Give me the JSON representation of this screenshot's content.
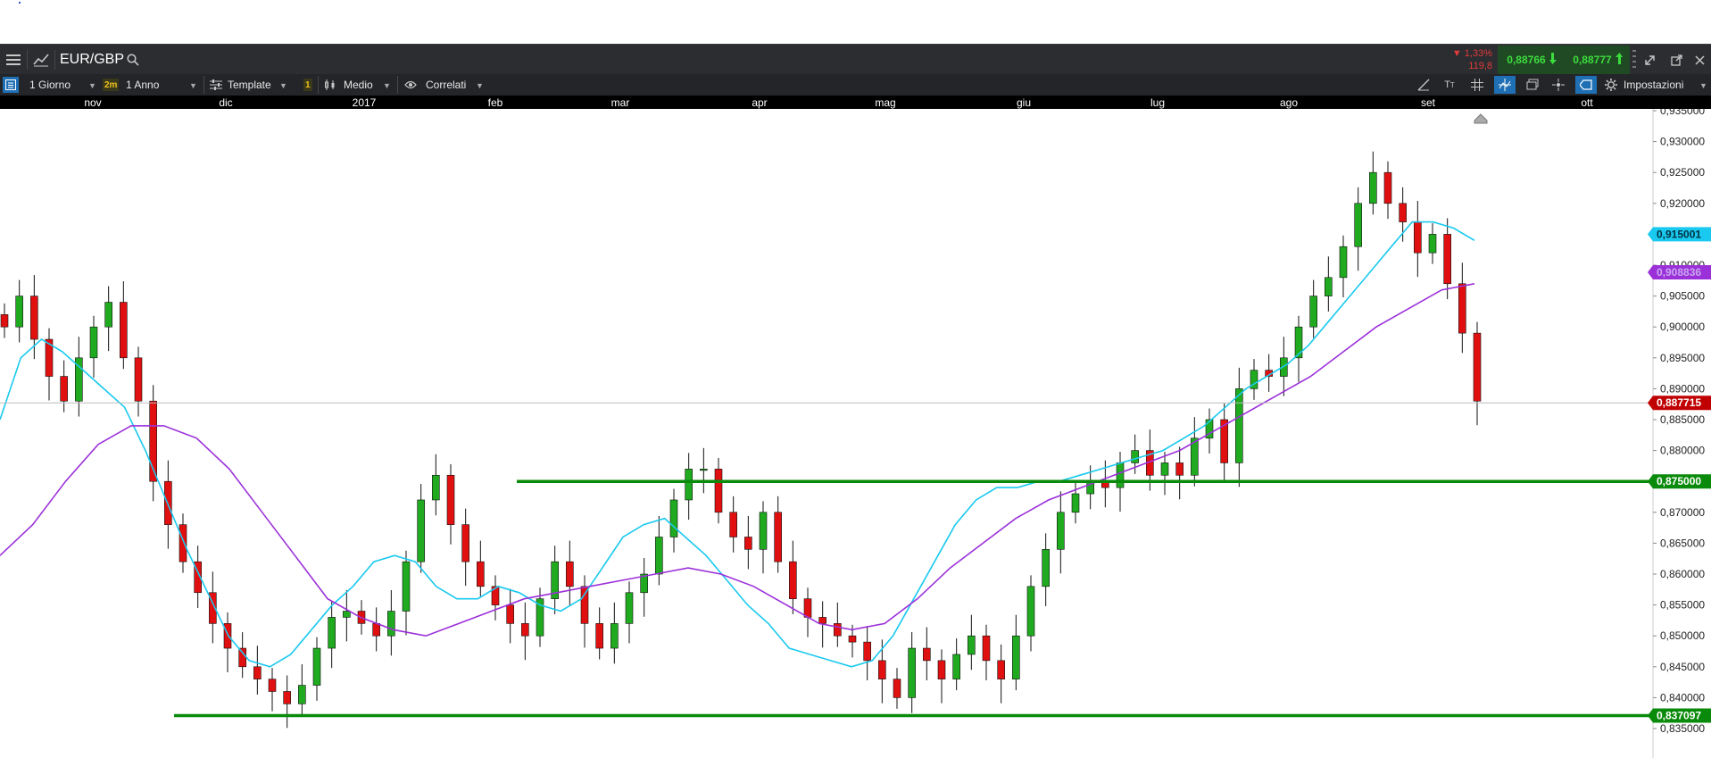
{
  "header": {
    "symbol": "EUR/GBP",
    "change_pct": "▼ 1,33%",
    "change_pts": "119,8",
    "bid": "0,88766",
    "ask": "0,88777"
  },
  "toolbar": {
    "interval": "1 Giorno",
    "badge_2m": "2m",
    "range": "1 Anno",
    "template": "Template",
    "badge_1": "1",
    "medio": "Medio",
    "correlati": "Correlati",
    "impostazioni": "Impostazioni"
  },
  "months": [
    "nov",
    "dic",
    "2017",
    "feb",
    "mar",
    "apr",
    "mag",
    "giu",
    "lug",
    "ago",
    "set",
    "ott"
  ],
  "colors": {
    "up": "#1faa1f",
    "down": "#e01010",
    "ma_fast": "#19c9ef",
    "ma_slow": "#9b30d9",
    "level": "#0a8a0a",
    "last": "#c00000"
  },
  "icons": [
    "menu-icon",
    "line-chart-icon",
    "search-icon",
    "maximize-icon",
    "popout-icon",
    "close-icon",
    "draw-icon",
    "text-size-icon",
    "grid-icon",
    "crosshair-icon",
    "layers-icon",
    "pin-icon",
    "tag-icon",
    "settings-icon"
  ],
  "chart_data": {
    "type": "line",
    "title": "EUR/GBP",
    "x_labels": [
      "nov",
      "dic",
      "2017",
      "feb",
      "mar",
      "apr",
      "mag",
      "giu",
      "lug",
      "ago",
      "set",
      "ott"
    ],
    "y_ticks": [
      "0,935000",
      "0,930000",
      "0,925000",
      "0,920000",
      "0,915000",
      "0,910000",
      "0,905000",
      "0,900000",
      "0,895000",
      "0,890000",
      "0,885000",
      "0,880000",
      "0,875000",
      "0,870000",
      "0,865000",
      "0,860000",
      "0,855000",
      "0,850000",
      "0,845000",
      "0,840000",
      "0,835000"
    ],
    "ylim": [
      0.8325,
      0.9355
    ],
    "tags": {
      "ma_fast": "0,915001",
      "ma_slow": "0,908836",
      "last": "0,887715",
      "level_high": "0,875000",
      "level_low": "0,837097"
    },
    "levels": [
      0.875,
      0.837097
    ],
    "last_price": 0.887715,
    "series": [
      {
        "values": [
          0.9,
          0.905,
          0.898,
          0.892,
          0.888,
          0.895,
          0.9,
          0.904,
          0.895,
          0.888,
          0.875,
          0.868,
          0.862,
          0.857,
          0.852,
          0.848,
          0.845,
          0.843,
          0.841,
          0.839,
          0.842,
          0.848,
          0.853,
          0.854,
          0.852,
          0.85,
          0.854,
          0.862,
          0.872,
          0.876,
          0.868,
          0.862,
          0.858,
          0.855,
          0.852,
          0.85,
          0.856,
          0.862,
          0.858,
          0.852,
          0.848,
          0.852,
          0.857,
          0.86,
          0.866,
          0.872,
          0.877,
          0.877,
          0.87,
          0.866,
          0.864,
          0.87,
          0.862,
          0.856,
          0.853,
          0.852,
          0.85,
          0.849,
          0.846,
          0.843,
          0.84,
          0.848,
          0.846,
          0.843,
          0.847,
          0.85,
          0.846,
          0.843,
          0.85,
          0.858,
          0.864,
          0.87,
          0.873,
          0.875,
          0.874,
          0.878,
          0.88,
          0.876,
          0.878,
          0.876,
          0.882,
          0.885,
          0.878,
          0.89,
          0.893,
          0.892,
          0.895,
          0.9,
          0.905,
          0.908,
          0.913,
          0.92,
          0.925,
          0.92,
          0.917,
          0.912,
          0.915,
          0.907,
          0.899,
          0.888
        ]
      },
      {
        "values": [
          0.885,
          0.895,
          0.898,
          0.896,
          0.893,
          0.89,
          0.887,
          0.88,
          0.872,
          0.864,
          0.857,
          0.85,
          0.846,
          0.845,
          0.847,
          0.851,
          0.855,
          0.858,
          0.862,
          0.863,
          0.862,
          0.858,
          0.856,
          0.856,
          0.858,
          0.857,
          0.855,
          0.854,
          0.856,
          0.861,
          0.866,
          0.868,
          0.869,
          0.866,
          0.863,
          0.859,
          0.855,
          0.852,
          0.848,
          0.847,
          0.846,
          0.845,
          0.846,
          0.85,
          0.856,
          0.862,
          0.868,
          0.872,
          0.874,
          0.874,
          0.875,
          0.875,
          0.876,
          0.877,
          0.878,
          0.879,
          0.88,
          0.882,
          0.884,
          0.887,
          0.89,
          0.892,
          0.894,
          0.897,
          0.901,
          0.905,
          0.909,
          0.913,
          0.917,
          0.917,
          0.916,
          0.914
        ]
      },
      {
        "values": [
          0.863,
          0.868,
          0.875,
          0.881,
          0.884,
          0.884,
          0.882,
          0.877,
          0.87,
          0.863,
          0.856,
          0.853,
          0.851,
          0.85,
          0.852,
          0.854,
          0.856,
          0.857,
          0.858,
          0.859,
          0.86,
          0.861,
          0.86,
          0.858,
          0.855,
          0.852,
          0.851,
          0.852,
          0.856,
          0.861,
          0.865,
          0.869,
          0.872,
          0.874,
          0.876,
          0.878,
          0.88,
          0.883,
          0.886,
          0.889,
          0.892,
          0.896,
          0.9,
          0.903,
          0.906,
          0.907
        ]
      }
    ]
  }
}
